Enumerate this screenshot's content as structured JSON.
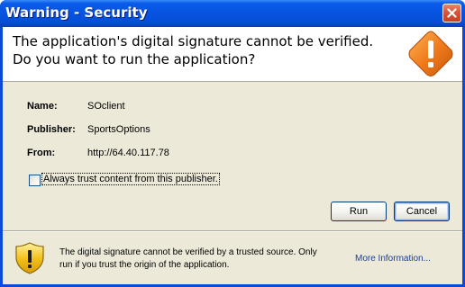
{
  "window": {
    "title": "Warning - Security"
  },
  "header": {
    "line1": "The application's digital signature cannot be verified.",
    "line2": "Do you want to run the application?"
  },
  "details": {
    "name_label": "Name:",
    "name_value": "SOclient",
    "publisher_label": "Publisher:",
    "publisher_value": "SportsOptions",
    "from_label": "From:",
    "from_value": "http://64.40.117.78"
  },
  "trust_checkbox": {
    "label": "Always trust content from this publisher.",
    "checked": false
  },
  "buttons": {
    "run": "Run",
    "cancel": "Cancel"
  },
  "footer": {
    "line1": "The digital signature cannot be verified by a trusted source.  Only",
    "line2": "run if you trust the origin of the application.",
    "more_info": "More Information..."
  },
  "colors": {
    "titlebar": "#0754e1",
    "dialog_bg": "#ece9d8",
    "warning_orange": "#f07c1c",
    "shield_yellow": "#f3c11c",
    "link": "#1c3f9a"
  },
  "icons": {
    "header": "warning-diamond-icon",
    "footer": "warning-shield-icon",
    "close": "close-icon"
  }
}
